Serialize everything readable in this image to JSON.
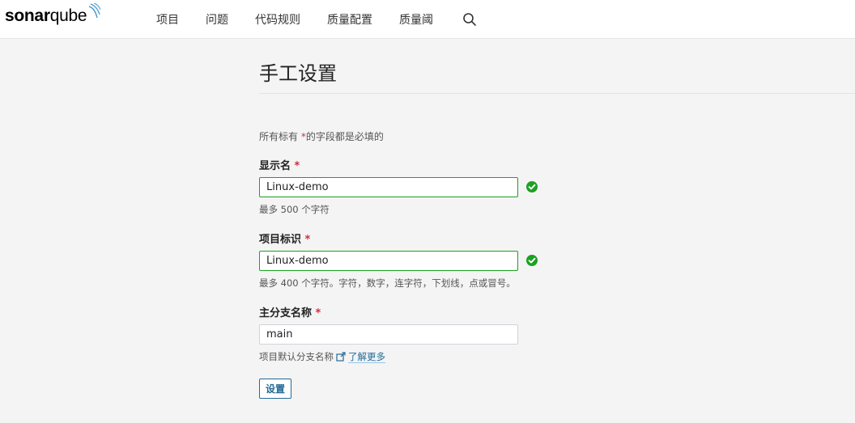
{
  "header": {
    "logo": {
      "strong": "sonar",
      "light": "qube"
    },
    "nav": [
      "项目",
      "问题",
      "代码规则",
      "质量配置",
      "质量阈"
    ],
    "icons": {
      "search": "search-icon"
    }
  },
  "page": {
    "title": "手工设置",
    "required_note_prefix": "所有标有",
    "required_note_star": "*",
    "required_note_suffix": "的字段都是必填的"
  },
  "form": {
    "display_name": {
      "label": "显示名",
      "star": "*",
      "value": "Linux-demo",
      "help": "最多 500 个字符"
    },
    "project_key": {
      "label": "项目标识",
      "star": "*",
      "value": "Linux-demo",
      "help": "最多 400 个字符。字符，数字，连字符，下划线，点或冒号。"
    },
    "main_branch": {
      "label": "主分支名称",
      "star": "*",
      "value": "main",
      "help": "项目默认分支名称",
      "link": "了解更多"
    },
    "submit_label": "设置"
  },
  "colors": {
    "valid": "#1ca121",
    "link": "#236a97",
    "required": "#d02f3a"
  }
}
